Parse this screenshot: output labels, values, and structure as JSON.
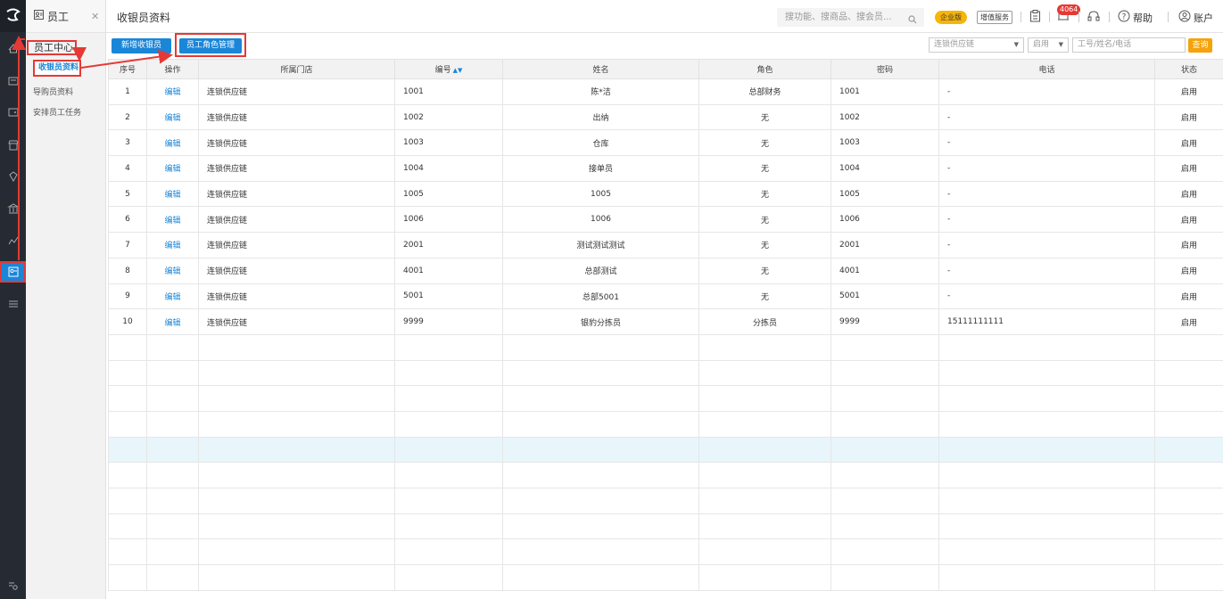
{
  "sidebar": {
    "module_title": "员工",
    "group_label": "员工中心",
    "items": [
      {
        "label": "收银员资料",
        "active": true
      },
      {
        "label": "导购员资料",
        "active": false
      },
      {
        "label": "安排员工任务",
        "active": false
      }
    ]
  },
  "rail_icons": [
    "home-icon",
    "cart-icon",
    "wallet-icon",
    "store-icon",
    "gem-icon",
    "bank-icon",
    "chart-icon",
    "staff-icon",
    "settings-icon",
    "search-menu-icon"
  ],
  "header": {
    "page_title": "收银员资料",
    "search_placeholder": "搜功能、搜商品、搜会员...",
    "enterprise_badge": "企业版",
    "value_added": "增值服务",
    "notify_count": "4064",
    "help": "帮助",
    "account": "账户"
  },
  "toolbar": {
    "add_cashier": "新增收银员",
    "role_manage": "员工角色管理",
    "store_filter": "连锁供应链",
    "status_filter": "启用",
    "keyword_placeholder": "工号/姓名/电话",
    "query": "查询"
  },
  "table": {
    "columns": [
      "序号",
      "操作",
      "所属门店",
      "编号",
      "姓名",
      "角色",
      "密码",
      "电话",
      "状态"
    ],
    "rows": [
      {
        "no": "1",
        "op": "编辑",
        "store": "连锁供应链",
        "code": "1001",
        "name": "陈*洁",
        "role": "总部财务",
        "pwd": "1001",
        "phone": "-",
        "status": "启用"
      },
      {
        "no": "2",
        "op": "编辑",
        "store": "连锁供应链",
        "code": "1002",
        "name": "出纳",
        "role": "无",
        "pwd": "1002",
        "phone": "-",
        "status": "启用"
      },
      {
        "no": "3",
        "op": "编辑",
        "store": "连锁供应链",
        "code": "1003",
        "name": "仓库",
        "role": "无",
        "pwd": "1003",
        "phone": "-",
        "status": "启用"
      },
      {
        "no": "4",
        "op": "编辑",
        "store": "连锁供应链",
        "code": "1004",
        "name": "接单员",
        "role": "无",
        "pwd": "1004",
        "phone": "-",
        "status": "启用"
      },
      {
        "no": "5",
        "op": "编辑",
        "store": "连锁供应链",
        "code": "1005",
        "name": "1005",
        "role": "无",
        "pwd": "1005",
        "phone": "-",
        "status": "启用"
      },
      {
        "no": "6",
        "op": "编辑",
        "store": "连锁供应链",
        "code": "1006",
        "name": "1006",
        "role": "无",
        "pwd": "1006",
        "phone": "-",
        "status": "启用"
      },
      {
        "no": "7",
        "op": "编辑",
        "store": "连锁供应链",
        "code": "2001",
        "name": "测试测试测试",
        "role": "无",
        "pwd": "2001",
        "phone": "-",
        "status": "启用"
      },
      {
        "no": "8",
        "op": "编辑",
        "store": "连锁供应链",
        "code": "4001",
        "name": "总部测试",
        "role": "无",
        "pwd": "4001",
        "phone": "-",
        "status": "启用"
      },
      {
        "no": "9",
        "op": "编辑",
        "store": "连锁供应链",
        "code": "5001",
        "name": "总部5001",
        "role": "无",
        "pwd": "5001",
        "phone": "-",
        "status": "启用"
      },
      {
        "no": "10",
        "op": "编辑",
        "store": "连锁供应链",
        "code": "9999",
        "name": "银豹分拣员",
        "role": "分拣员",
        "pwd": "9999",
        "phone": "15111111111",
        "status": "启用"
      }
    ],
    "empty_rows": 10,
    "highlighted_empty_row": 4
  },
  "colors": {
    "primary": "#1a86d8",
    "annotation": "#e53935",
    "rail": "#262b33",
    "query": "#f5a30a"
  }
}
